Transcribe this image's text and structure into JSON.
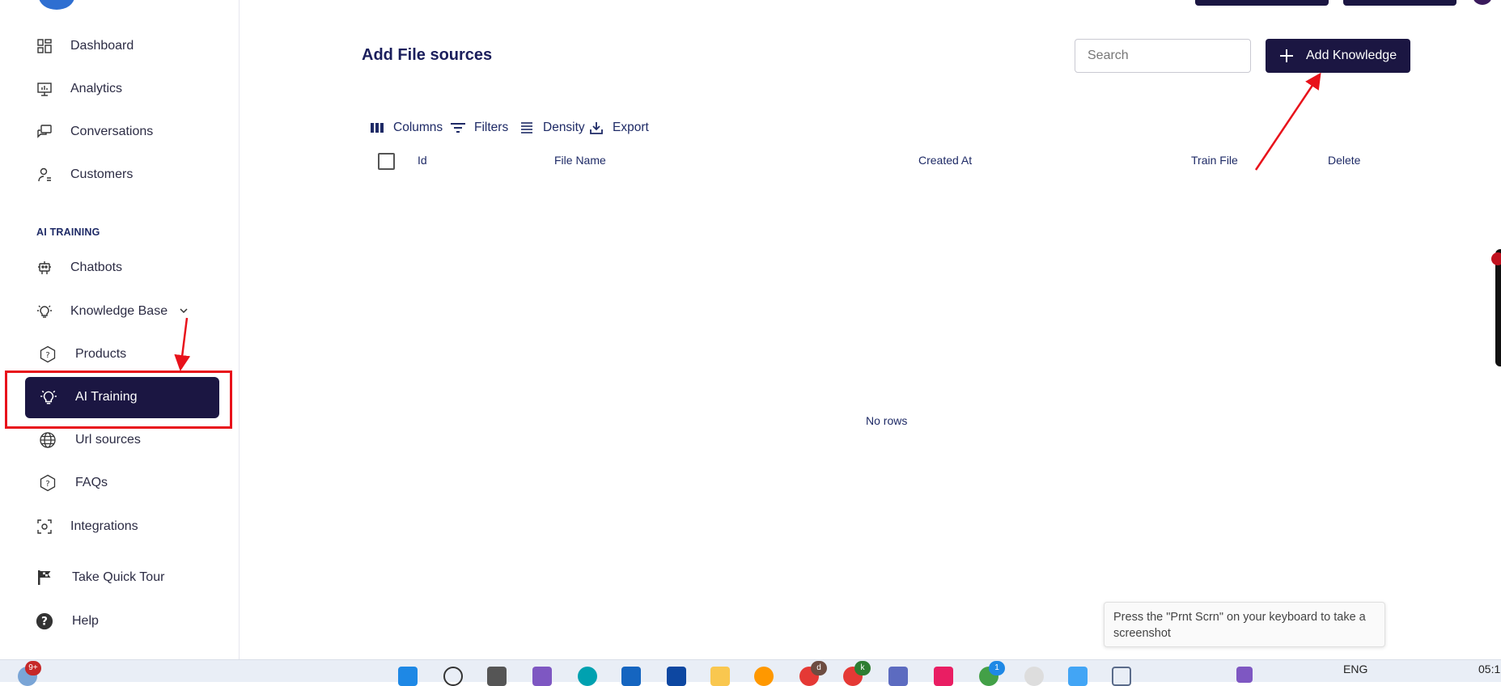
{
  "sidebar": {
    "items": [
      {
        "label": "Dashboard",
        "icon": "dashboard-icon"
      },
      {
        "label": "Analytics",
        "icon": "analytics-icon"
      },
      {
        "label": "Conversations",
        "icon": "conversations-icon"
      },
      {
        "label": "Customers",
        "icon": "customers-icon"
      }
    ],
    "section_title": "AI TRAINING",
    "training_items": [
      {
        "label": "Chatbots",
        "icon": "chatbot-icon"
      },
      {
        "label": "Knowledge Base",
        "icon": "lightbulb-icon"
      }
    ],
    "sub_items": [
      {
        "label": "Products",
        "icon": "hexagon-question-icon"
      },
      {
        "label": "AI Training",
        "icon": "lightbulb-icon",
        "active": true
      },
      {
        "label": "Url sources",
        "icon": "globe-icon"
      },
      {
        "label": "FAQs",
        "icon": "hexagon-question-icon"
      }
    ],
    "bottom_items": [
      {
        "label": "Integrations",
        "icon": "integrations-icon"
      },
      {
        "label": "Take Quick Tour",
        "icon": "flag-icon"
      },
      {
        "label": "Help",
        "icon": "help-icon"
      }
    ]
  },
  "main": {
    "title": "Add File sources",
    "search_placeholder": "Search",
    "add_button_label": "Add Knowledge",
    "toolbar": {
      "columns": "Columns",
      "filters": "Filters",
      "density": "Density",
      "export": "Export"
    },
    "columns": [
      "Id",
      "File Name",
      "Created At",
      "Train File",
      "Delete"
    ],
    "empty_text": "No rows"
  },
  "tooltip": {
    "text": "Press the \"Prnt Scrn\" on your keyboard to take a screenshot"
  },
  "taskbar": {
    "notification_badge": "9+",
    "language": "ENG",
    "clock": "05:1",
    "app_badge_d": "d",
    "app_badge_k": "k",
    "app_badge_1": "1"
  },
  "colors": {
    "primary": "#1b1642",
    "heading": "#1b1f5c",
    "annotation_red": "#e8121b"
  }
}
